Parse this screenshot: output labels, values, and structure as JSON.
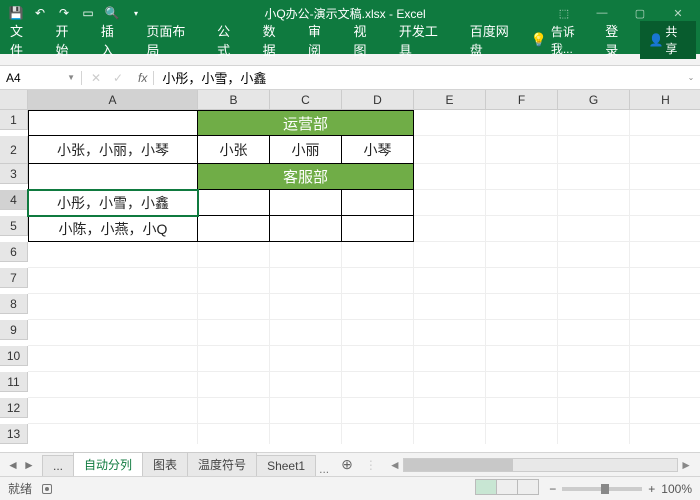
{
  "titlebar": {
    "title": "小Q办公-演示文稿.xlsx - Excel",
    "qat_icons": [
      "save-icon",
      "undo-icon",
      "redo-icon",
      "new-icon",
      "print-preview-icon",
      "customize-icon"
    ]
  },
  "window_controls": [
    "ribbon-min",
    "min",
    "max",
    "close"
  ],
  "ribbon": {
    "tabs": [
      "文件",
      "开始",
      "插入",
      "页面布局",
      "公式",
      "数据",
      "审阅",
      "视图",
      "开发工具",
      "百度网盘"
    ],
    "active_index": 0,
    "tell_me": "告诉我...",
    "login": "登录",
    "share": "共享"
  },
  "name_box": "A4",
  "formula_value": "小彤，小雪，小鑫",
  "columns": [
    "A",
    "B",
    "C",
    "D",
    "E",
    "F",
    "G",
    "H"
  ],
  "rows": [
    "1",
    "2",
    "3",
    "4",
    "5",
    "6",
    "7",
    "8",
    "9",
    "10",
    "11",
    "12",
    "13"
  ],
  "active_cell": {
    "row": 4,
    "col": "A"
  },
  "cells": {
    "r1": {
      "merged_b_d": "运营部"
    },
    "r2": {
      "a": "小张，小丽，小琴",
      "b": "小张",
      "c": "小丽",
      "d": "小琴"
    },
    "r3": {
      "merged_b_d": "客服部"
    },
    "r4": {
      "a": "小彤，小雪，小鑫"
    },
    "r5": {
      "a": "小陈，小燕，小Q"
    }
  },
  "sheet_tabs": {
    "items": [
      "...",
      "自动分列",
      "图表",
      "温度符号",
      "Sheet1"
    ],
    "active_index": 1,
    "overflow_hint": "..."
  },
  "status": {
    "mode": "就绪",
    "zoom": "100%",
    "zoom_minus": "−",
    "zoom_plus": "+"
  }
}
